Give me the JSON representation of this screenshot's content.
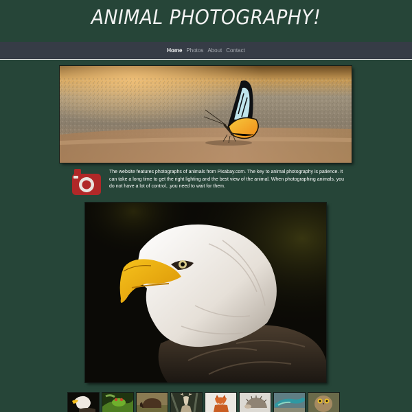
{
  "site": {
    "title": "ANIMAL PHOTOGRAPHY!"
  },
  "nav": {
    "items": [
      {
        "label": "Home",
        "active": true
      },
      {
        "label": "Photos",
        "active": false
      },
      {
        "label": "About",
        "active": false
      },
      {
        "label": "Contact",
        "active": false
      }
    ]
  },
  "intro": {
    "text": "The website features photographs of animals from Pixabay.com. The key to animal photography is patience. It can take a long time to get the right lighting and the best view of the animal. When photographing animals, you do not have a lot of control...you need to wait for them.",
    "icon": "camera-icon"
  },
  "hero": {
    "subject": "butterfly-photo"
  },
  "main_photo": {
    "subject": "bald-eagle-photo"
  },
  "thumbnails": [
    {
      "subject": "eagle"
    },
    {
      "subject": "frog"
    },
    {
      "subject": "bison"
    },
    {
      "subject": "deer"
    },
    {
      "subject": "fox"
    },
    {
      "subject": "hedgehog"
    },
    {
      "subject": "lizard"
    },
    {
      "subject": "owl"
    }
  ],
  "colors": {
    "background": "#264538",
    "navbar": "#363c46",
    "camera_icon": "#b02828",
    "text": "#ffffff"
  }
}
